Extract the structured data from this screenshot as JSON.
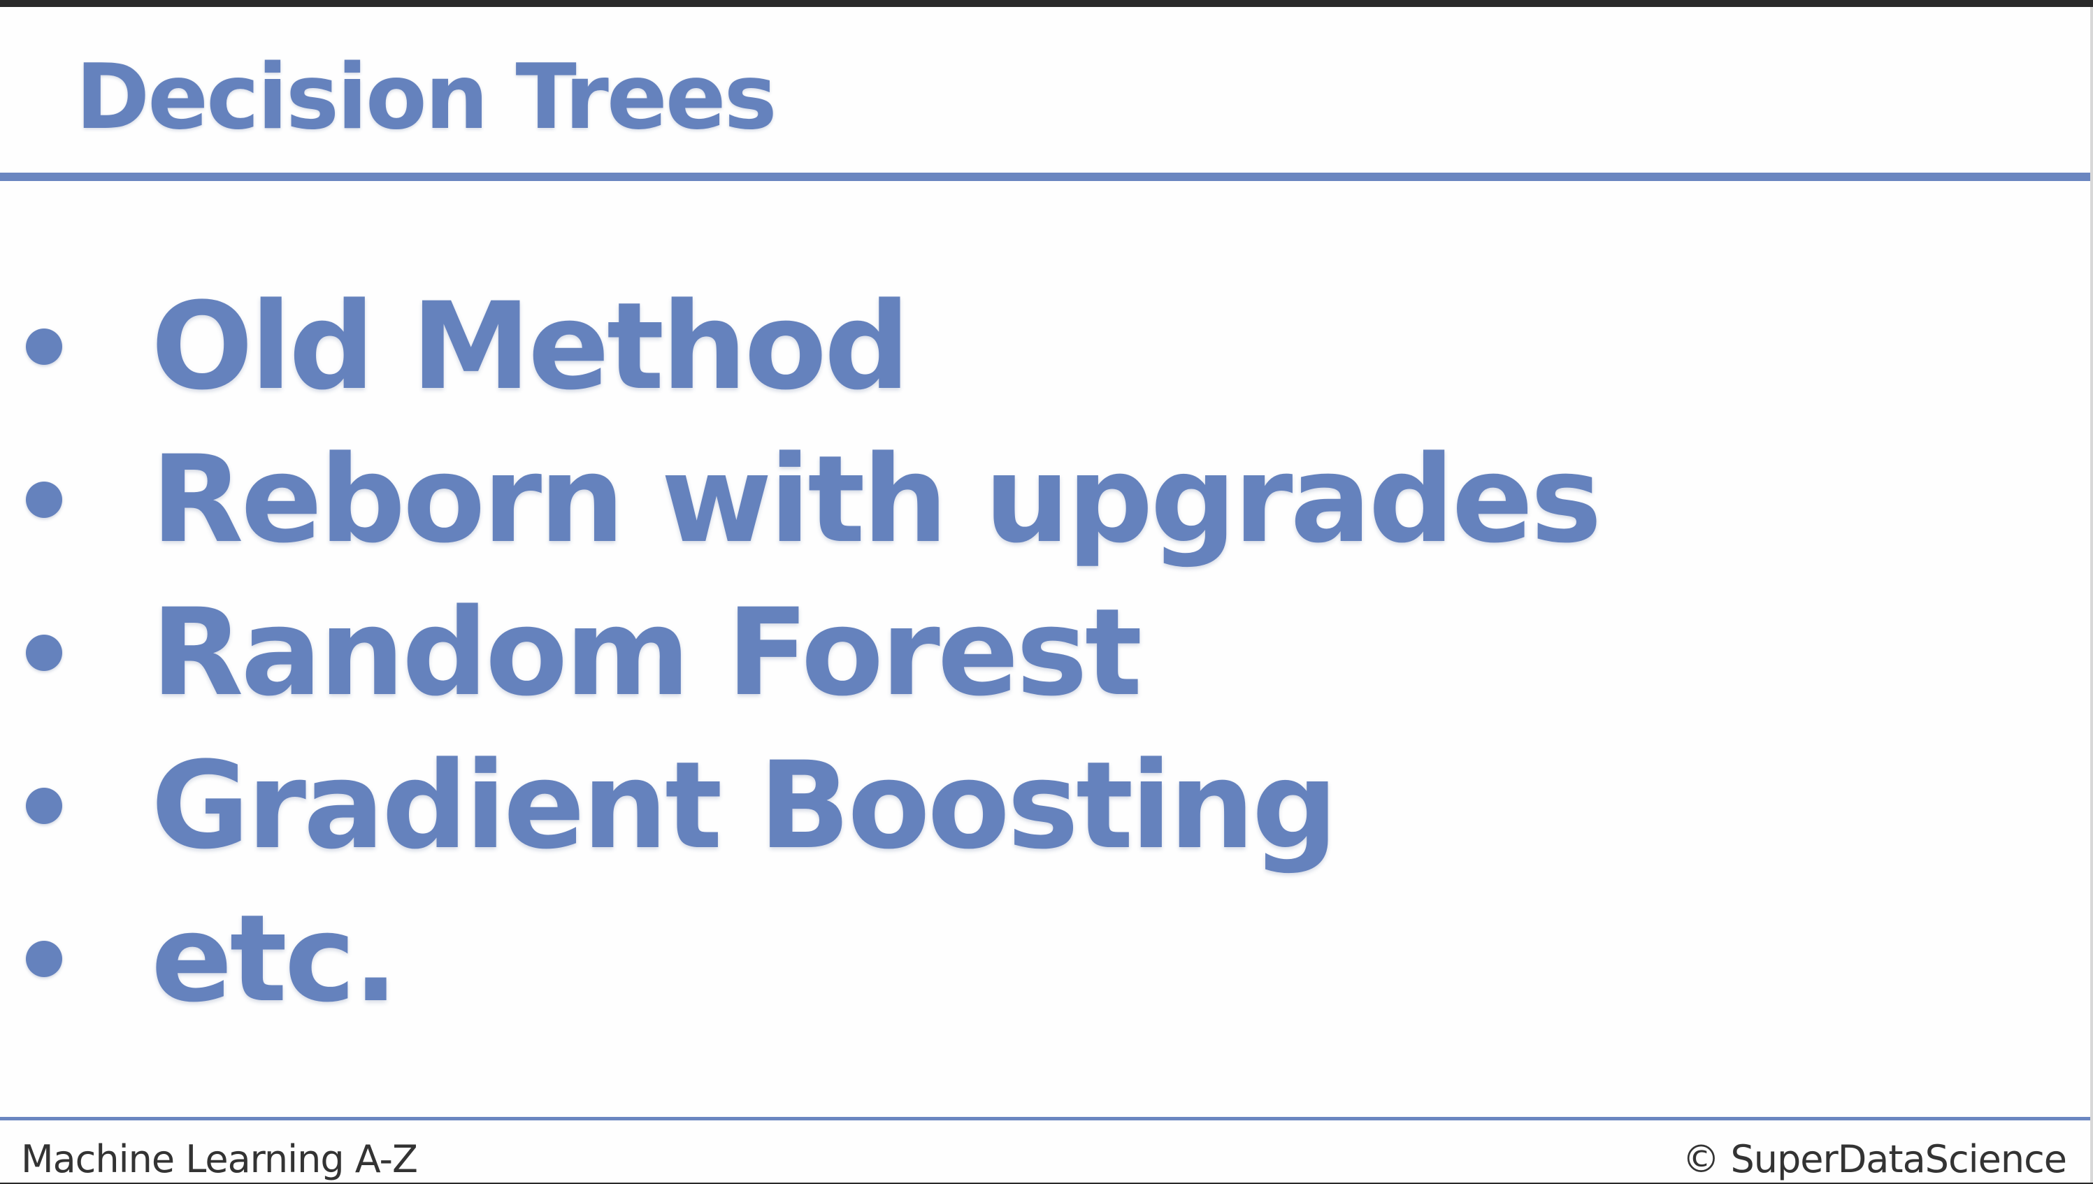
{
  "slide": {
    "title": "Decision Trees",
    "bullets": [
      {
        "text": "Old Method"
      },
      {
        "text": "Reborn with upgrades"
      },
      {
        "text": "Random Forest"
      },
      {
        "text": "Gradient Boosting"
      },
      {
        "text": "etc."
      }
    ],
    "accent_color": "#6582bd"
  },
  "footer": {
    "left_text": "Machine Learning A-Z",
    "right_text": "© SuperDataScience"
  }
}
